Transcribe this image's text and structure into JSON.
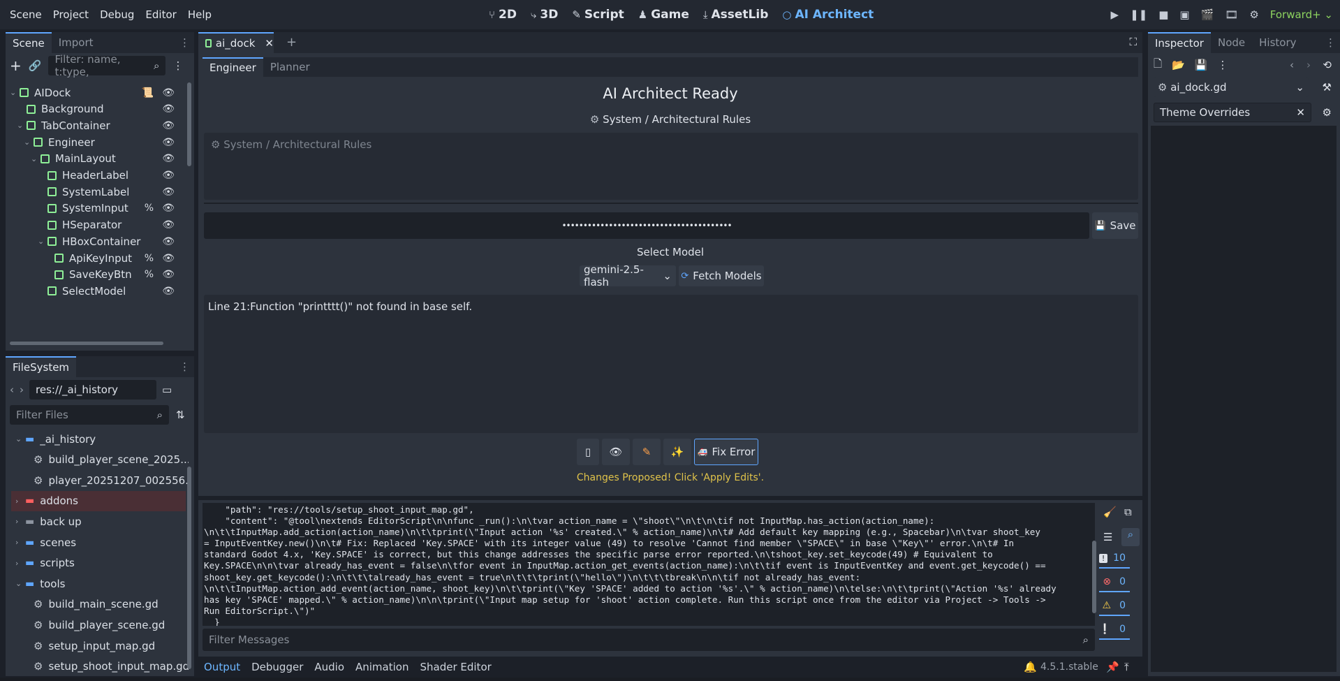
{
  "menu": [
    "Scene",
    "Project",
    "Debug",
    "Editor",
    "Help"
  ],
  "workspaces": [
    {
      "icon": "⑂",
      "label": "2D"
    },
    {
      "icon": "⤷",
      "label": "3D"
    },
    {
      "icon": "✎",
      "label": "Script"
    },
    {
      "icon": "♟",
      "label": "Game"
    },
    {
      "icon": "⤓",
      "label": "AssetLib"
    },
    {
      "icon": "○",
      "label": "AI Architect"
    }
  ],
  "renderer": "Forward+",
  "scene_dock": {
    "tabs": [
      "Scene",
      "Import"
    ],
    "filter_placeholder": "Filter: name, t:type,",
    "nodes": [
      {
        "name": "AIDock",
        "depth": 0,
        "arrow": "v",
        "color": "#8eef97",
        "script": true,
        "pct": false
      },
      {
        "name": "Background",
        "depth": 1,
        "arrow": "",
        "color": "#8eef97",
        "script": false,
        "pct": false
      },
      {
        "name": "TabContainer",
        "depth": 1,
        "arrow": "v",
        "color": "#8eef97",
        "script": false,
        "pct": false
      },
      {
        "name": "Engineer",
        "depth": 2,
        "arrow": "v",
        "color": "#8eef97",
        "script": false,
        "pct": false
      },
      {
        "name": "MainLayout",
        "depth": 3,
        "arrow": "v",
        "color": "#8eef97",
        "script": false,
        "pct": false
      },
      {
        "name": "HeaderLabel",
        "depth": 4,
        "arrow": "",
        "color": "#8eef97",
        "script": false,
        "pct": false
      },
      {
        "name": "SystemLabel",
        "depth": 4,
        "arrow": "",
        "color": "#8eef97",
        "script": false,
        "pct": false
      },
      {
        "name": "SystemInput",
        "depth": 4,
        "arrow": "",
        "color": "#8eef97",
        "script": false,
        "pct": true
      },
      {
        "name": "HSeparator",
        "depth": 4,
        "arrow": "",
        "color": "#8eef97",
        "script": false,
        "pct": false
      },
      {
        "name": "HBoxContainer",
        "depth": 4,
        "arrow": "v",
        "color": "#8eef97",
        "script": false,
        "pct": false
      },
      {
        "name": "ApiKeyInput",
        "depth": 5,
        "arrow": "",
        "color": "#8eef97",
        "script": false,
        "pct": true
      },
      {
        "name": "SaveKeyBtn",
        "depth": 5,
        "arrow": "",
        "color": "#8eef97",
        "script": false,
        "pct": true
      },
      {
        "name": "SelectModel",
        "depth": 4,
        "arrow": "",
        "color": "#8eef97",
        "script": false,
        "pct": false
      }
    ]
  },
  "filesystem": {
    "title": "FileSystem",
    "path": "res://_ai_history",
    "filter_placeholder": "Filter Files",
    "items": [
      {
        "name": "_ai_history",
        "type": "folder",
        "depth": 0,
        "arrow": "v",
        "color": "#5fa6ff"
      },
      {
        "name": "build_player_scene_2025...",
        "type": "file",
        "depth": 1
      },
      {
        "name": "player_20251207_002556...",
        "type": "file",
        "depth": 1
      },
      {
        "name": "addons",
        "type": "folder",
        "depth": 0,
        "arrow": ">",
        "color": "#ff5f5f",
        "highlight": true
      },
      {
        "name": "back up",
        "type": "folder",
        "depth": 0,
        "arrow": ">",
        "color": "#8d94a0"
      },
      {
        "name": "scenes",
        "type": "folder",
        "depth": 0,
        "arrow": ">",
        "color": "#5fa6ff"
      },
      {
        "name": "scripts",
        "type": "folder",
        "depth": 0,
        "arrow": ">",
        "color": "#5fa6ff"
      },
      {
        "name": "tools",
        "type": "folder",
        "depth": 0,
        "arrow": "v",
        "color": "#5fa6ff"
      },
      {
        "name": "build_main_scene.gd",
        "type": "file",
        "depth": 1
      },
      {
        "name": "build_player_scene.gd",
        "type": "file",
        "depth": 1
      },
      {
        "name": "setup_input_map.gd",
        "type": "file",
        "depth": 1
      },
      {
        "name": "setup_shoot_input_map.gd",
        "type": "file",
        "depth": 1
      }
    ]
  },
  "editor_tab": "ai_dock",
  "main": {
    "tabs": [
      "Engineer",
      "Planner"
    ],
    "header": "AI Architect Ready",
    "system_label": "System / Architectural Rules",
    "system_placeholder": "System / Architectural Rules",
    "api_key_masked": "••••••••••••••••••••••••••••••••••••••••",
    "save_label": "Save",
    "select_model_label": "Select Model",
    "model_value": "gemini-2.5-flash",
    "fetch_label": "Fetch Models",
    "prompt_text": "Line 21:Function \"printttt()\" not found in base self.",
    "fix_label": "Fix Error",
    "status": "Changes Proposed! Click 'Apply Edits'."
  },
  "output": {
    "lines": [
      "    \"path\": \"res://tools/setup_shoot_input_map.gd\",",
      "    \"content\": \"@tool\\nextends EditorScript\\n\\nfunc _run():\\n\\tvar action_name = \\\"shoot\\\"\\n\\t\\n\\tif not InputMap.has_action(action_name):",
      "\\n\\t\\tInputMap.add_action(action_name)\\n\\t\\tprint(\\\"Input action '%s' created.\\\" % action_name)\\n\\t# Add default key mapping (e.g., Spacebar)\\n\\tvar shoot_key",
      "= InputEventKey.new()\\n\\t# Fix: Replaced 'Key.SPACE' with its integer value (49) to resolve 'Cannot find member \\\"SPACE\\\" in base \\\"Key\\\"' error.\\n\\t# In",
      "standard Godot 4.x, 'Key.SPACE' is correct, but this change addresses the specific parse error reported.\\n\\tshoot_key.set_keycode(49) # Equivalent to",
      "Key.SPACE\\n\\n\\tvar already_has_event = false\\n\\tfor event in InputMap.action_get_events(action_name):\\n\\t\\tif event is InputEventKey and event.get_keycode() ==",
      "shoot_key.get_keycode():\\n\\t\\t\\talready_has_event = true\\n\\t\\t\\tprint(\\\"hello\\\")\\n\\t\\t\\tbreak\\n\\n\\tif not already_has_event:",
      "\\n\\t\\tInputMap.action_add_event(action_name, shoot_key)\\n\\t\\tprint(\\\"Key 'SPACE' added to action '%s'.\\\" % action_name)\\n\\telse:\\n\\t\\tprint(\\\"Action '%s' already",
      "has key 'SPACE' mapped.\\\" % action_name)\\n\\n\\tprint(\\\"Input map setup for 'shoot' action complete. Run this script once from the editor via Project -> Tools ->",
      "Run EditorScript.\\\")\"",
      "  }"
    ],
    "filter_placeholder": "Filter Messages",
    "counts": {
      "messages": "10",
      "errors": "0",
      "warnings": "0",
      "editor": "0"
    }
  },
  "bottom_tabs": [
    "Output",
    "Debugger",
    "Audio",
    "Animation",
    "Shader Editor"
  ],
  "version": "4.5.1.stable",
  "inspector": {
    "tabs": [
      "Inspector",
      "Node",
      "History"
    ],
    "resource": "ai_dock.gd",
    "theme_overrides": "Theme Overrides"
  }
}
